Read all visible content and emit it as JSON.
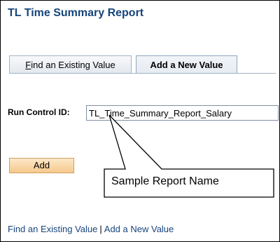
{
  "page": {
    "title": "TL Time Summary Report"
  },
  "tabs": {
    "find_first_letter": "F",
    "find_rest": "ind an Existing Value",
    "add": "Add a New Value"
  },
  "form": {
    "run_control_label": "Run Control ID:",
    "run_control_value": "TL_Time_Summary_Report_Salary"
  },
  "buttons": {
    "add": "Add"
  },
  "callout": {
    "text": "Sample Report Name"
  },
  "footer": {
    "find_link": "Find an Existing Value",
    "separator": "|",
    "add_link": "Add a New Value"
  }
}
